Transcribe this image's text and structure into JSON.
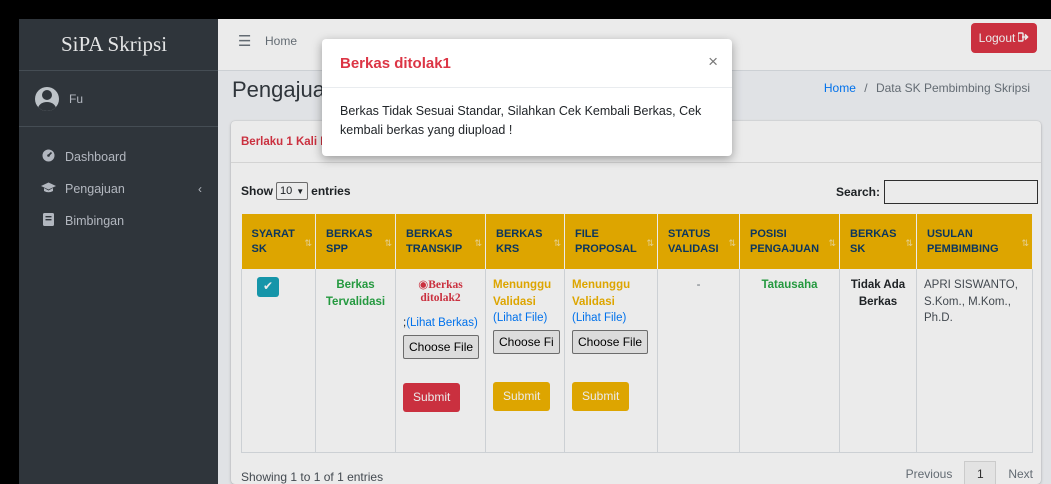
{
  "sidebar": {
    "brand": "SiPA Skripsi",
    "user_name": "Fu",
    "items": [
      {
        "label": "Dashboard",
        "icon": "dashboard-icon"
      },
      {
        "label": "Pengajuan",
        "icon": "graduation-cap-icon",
        "caret": "‹"
      },
      {
        "label": "Bimbingan",
        "icon": "book-icon"
      }
    ]
  },
  "navbar": {
    "home_label": "Home",
    "logout_label": "Logout"
  },
  "header": {
    "title": "Pengajuan",
    "breadcrumb_home": "Home",
    "breadcrumb_sep": "/",
    "breadcrumb_current": "Data SK Pembimbing Skripsi"
  },
  "card": {
    "note": "Berlaku 1 Kali I"
  },
  "table_controls": {
    "show_label": "Show",
    "length_value": "10",
    "entries_label": "entries",
    "search_label": "Search:"
  },
  "table": {
    "headers": [
      "SYARAT SK",
      "BERKAS SPP",
      "BERKAS TRANSKIP",
      "BERKAS KRS",
      "FILE PROPOSAL",
      "STATUS VALIDASI",
      "POSISI PENGAJUAN",
      "BERKAS SK",
      "USULAN PEMBIMBING"
    ],
    "row": {
      "spp_status": "Berkas Tervalidasi",
      "transkip_status": "Berkas ditolak2",
      "transkip_prefix": ";",
      "transkip_link": "(Lihat Berkas)",
      "transkip_file_btn": "Choose File",
      "transkip_submit": "Submit",
      "krs_status": "Menunggu Validasi",
      "krs_link": "(Lihat File)",
      "krs_file_btn": "Choose Fi",
      "krs_submit": "Submit",
      "proposal_status": "Menunggu Validasi",
      "proposal_link": "(Lihat File)",
      "proposal_file_btn": "Choose File",
      "proposal_submit": "Submit",
      "status_validasi": "-",
      "posisi": "Tatausaha",
      "berkas_sk": "Tidak Ada Berkas",
      "pembimbing": "APRI SISWANTO, S.Kom., M.Kom., Ph.D."
    }
  },
  "footer": {
    "info": "Showing 1 to 1 of 1 entries",
    "prev": "Previous",
    "page": "1",
    "next": "Next"
  },
  "modal": {
    "title": "Berkas ditolak1",
    "close": "×",
    "body": "Berkas Tidak Sesuai Standar, Silahkan Cek Kembali Berkas, Cek kembali berkas yang diupload !"
  },
  "colors": {
    "sidebar_bg": "#343a40",
    "header_yellow": "#f0b400",
    "danger": "#dc3545",
    "success": "#28a745",
    "primary": "#007bff",
    "info": "#17a2b8"
  }
}
